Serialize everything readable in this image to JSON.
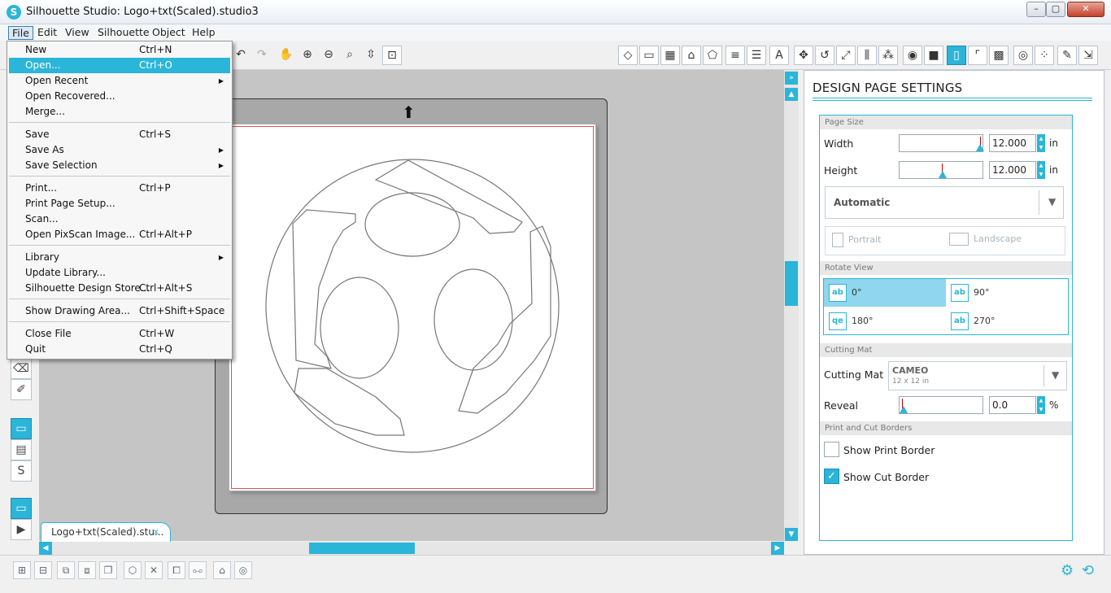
{
  "window": {
    "title": "Silhouette Studio: Logo+txt(Scaled).studio3",
    "btn_min": "–",
    "btn_max": "▢",
    "btn_close": "✕"
  },
  "menubar": {
    "items": [
      "File",
      "Edit",
      "View",
      "Silhouette",
      "Object",
      "Help"
    ]
  },
  "file_menu": {
    "items": [
      {
        "label": "New",
        "shortcut": "Ctrl+N"
      },
      {
        "label": "Open...",
        "shortcut": "Ctrl+O",
        "highlighted": true
      },
      {
        "label": "Open Recent",
        "shortcut": "",
        "submenu": true
      },
      {
        "label": "Open Recovered...",
        "shortcut": ""
      },
      {
        "label": "Merge...",
        "shortcut": ""
      },
      {
        "label": "Save",
        "shortcut": "Ctrl+S"
      },
      {
        "label": "Save As",
        "shortcut": "",
        "submenu": true
      },
      {
        "label": "Save Selection",
        "shortcut": "",
        "submenu": true
      },
      {
        "label": "Print...",
        "shortcut": "Ctrl+P"
      },
      {
        "label": "Print Page Setup...",
        "shortcut": ""
      },
      {
        "label": "Scan...",
        "shortcut": ""
      },
      {
        "label": "Open PixScan Image...",
        "shortcut": "Ctrl+Alt+P"
      },
      {
        "label": "Library",
        "shortcut": "",
        "submenu": true
      },
      {
        "label": "Update Library...",
        "shortcut": ""
      },
      {
        "label": "Silhouette Design Store...",
        "shortcut": "Ctrl+Alt+S"
      },
      {
        "label": "Show Drawing Area...",
        "shortcut": "Ctrl+Shift+Space"
      },
      {
        "label": "Close File",
        "shortcut": "Ctrl+W"
      },
      {
        "label": "Quit",
        "shortcut": "Ctrl+Q"
      }
    ],
    "submenu_glyph": "▶"
  },
  "document_tab": {
    "label": "Logo+txt(Scaled).stu...",
    "close": "x"
  },
  "panel": {
    "title": "DESIGN PAGE SETTINGS",
    "page_size": {
      "section": "Page Size",
      "width_label": "Width",
      "width_value": "12.000",
      "width_unit": "in",
      "height_label": "Height",
      "height_value": "12.000",
      "height_unit": "in",
      "size_dropdown": "Automatic",
      "portrait": "Portrait",
      "landscape": "Landscape"
    },
    "rotate_view": {
      "section": "Rotate View",
      "options": [
        {
          "label": "0°",
          "icon": "ab",
          "selected": true
        },
        {
          "label": "90°",
          "icon": "ab",
          "selected": false
        },
        {
          "label": "180°",
          "icon": "qe",
          "selected": false
        },
        {
          "label": "270°",
          "icon": "ab",
          "selected": false
        }
      ]
    },
    "cutting_mat": {
      "section": "Cutting Mat",
      "mat_label": "Cutting Mat",
      "mat_value": "CAMEO",
      "mat_sub": "12 x 12 in",
      "reveal_label": "Reveal",
      "reveal_value": "0.0",
      "reveal_unit": "%"
    },
    "borders": {
      "section": "Print and Cut Borders",
      "show_print": "Show Print Border",
      "show_print_checked": false,
      "show_cut": "Show Cut Border",
      "show_cut_checked": true
    }
  },
  "icons": {
    "accent": "#2bb5d8",
    "checkmark": "✓",
    "dropdown_caret": "▼",
    "spin_up": "▲",
    "spin_down": "▼",
    "arrow_up": "▲",
    "arrow_down": "▼",
    "arrow_left": "◀",
    "arrow_right": "▶",
    "double_right": "»",
    "mat_arrow": "⬆",
    "gear": "⚙",
    "refresh": "⟲"
  },
  "toolbar": {
    "undo": "↶",
    "redo": "↷",
    "pan": "✋",
    "zoom_in": "⊕",
    "zoom_out": "⊖",
    "zoom_box": "⌕",
    "zoom_drag": "⇳",
    "zoom_fit": "⊡",
    "text_tool": "A"
  }
}
